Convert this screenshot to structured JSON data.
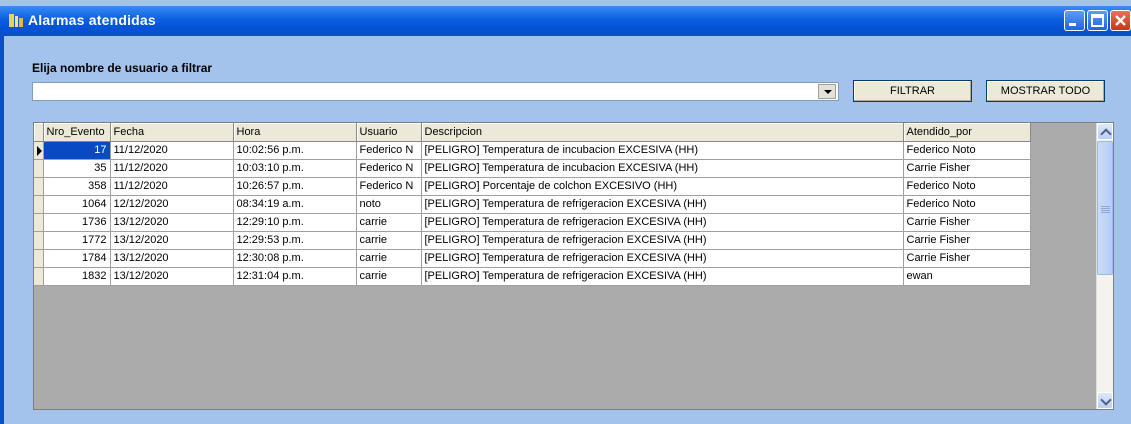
{
  "window": {
    "title": "Alarmas atendidas",
    "icon": "app-icon"
  },
  "filter": {
    "label": "Elija nombre de usuario a filtrar",
    "combo_value": "",
    "buttons": {
      "filtrar": "FILTRAR",
      "mostrar_todo": "MOSTRAR TODO"
    }
  },
  "grid": {
    "columns": [
      "Nro_Evento",
      "Fecha",
      "Hora",
      "Usuario",
      "Descripcion",
      "Atendido_por"
    ],
    "rows": [
      [
        "17",
        "11/12/2020",
        "10:02:56 p.m.",
        "Federico N",
        "[PELIGRO] Temperatura de incubacion EXCESIVA (HH)",
        "Federico Noto"
      ],
      [
        "35",
        "11/12/2020",
        "10:03:10 p.m.",
        "Federico N",
        "[PELIGRO] Temperatura de incubacion EXCESIVA (HH)",
        "Carrie Fisher"
      ],
      [
        "358",
        "11/12/2020",
        "10:26:57 p.m.",
        "Federico N",
        "[PELIGRO] Porcentaje de colchon EXCESIVO (HH)",
        "Federico Noto"
      ],
      [
        "1064",
        "12/12/2020",
        "08:34:19 a.m.",
        "noto",
        "[PELIGRO] Temperatura de refrigeracion EXCESIVA (HH)",
        "Federico Noto"
      ],
      [
        "1736",
        "13/12/2020",
        "12:29:10 p.m.",
        "carrie",
        "[PELIGRO] Temperatura de refrigeracion EXCESIVA (HH)",
        "Carrie Fisher"
      ],
      [
        "1772",
        "13/12/2020",
        "12:29:53 p.m.",
        "carrie",
        "[PELIGRO] Temperatura de refrigeracion EXCESIVA (HH)",
        "Carrie Fisher"
      ],
      [
        "1784",
        "13/12/2020",
        "12:30:08 p.m.",
        "carrie",
        "[PELIGRO] Temperatura de refrigeracion EXCESIVA (HH)",
        "Carrie Fisher"
      ],
      [
        "1832",
        "13/12/2020",
        "12:31:04 p.m.",
        "carrie",
        "[PELIGRO] Temperatura de refrigeracion EXCESIVA (HH)",
        "ewan"
      ]
    ],
    "selected_row": 0,
    "selection_color": "#0a49c4"
  },
  "colors": {
    "titlebar": "#0553d6",
    "window_bg": "#a4c3ec",
    "grid_bg": "#ababab"
  }
}
